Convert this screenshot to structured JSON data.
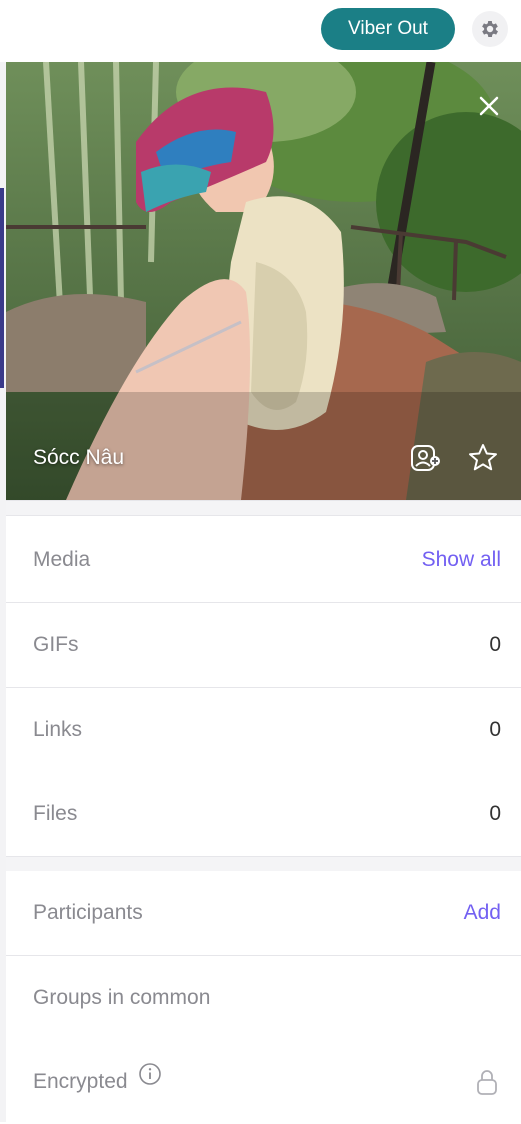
{
  "header": {
    "viber_out_label": "Viber Out",
    "settings_icon": "gear-icon"
  },
  "profile": {
    "name": "Sócc Nâu",
    "close_icon": "close-icon",
    "actions": [
      "add-contact-icon",
      "star-icon"
    ]
  },
  "sections": {
    "media": {
      "label": "Media",
      "action": "Show all"
    },
    "gifs": {
      "label": "GIFs",
      "count": "0"
    },
    "links": {
      "label": "Links",
      "count": "0"
    },
    "files": {
      "label": "Files",
      "count": "0"
    },
    "participants": {
      "label": "Participants",
      "action": "Add"
    },
    "groups": {
      "label": "Groups in common"
    },
    "encrypted": {
      "label": "Encrypted",
      "info_icon": "info-icon",
      "lock_icon": "lock-icon"
    }
  },
  "colors": {
    "brand": "#1b7f86",
    "accent": "#7360f2",
    "muted_text": "#8a8a90"
  }
}
